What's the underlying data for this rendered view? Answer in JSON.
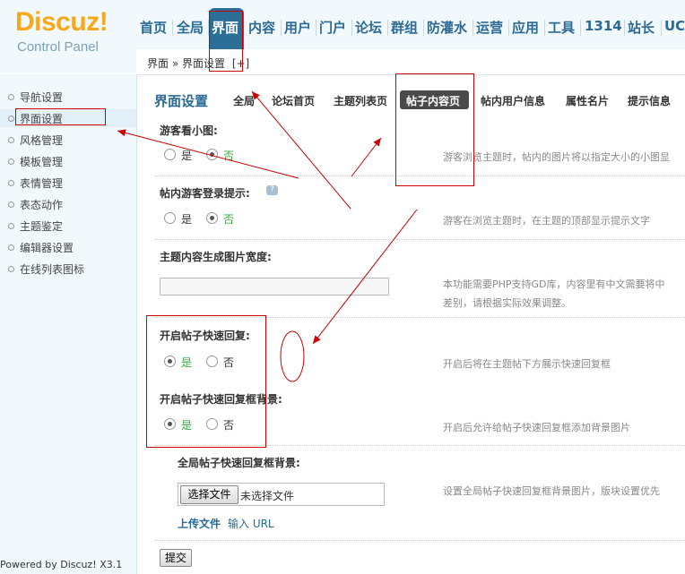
{
  "logo": {
    "brand": "Discuz!",
    "subtitle": "Control Panel"
  },
  "top_nav": [
    {
      "label": "首页"
    },
    {
      "label": "全局"
    },
    {
      "label": "界面"
    },
    {
      "label": "内容"
    },
    {
      "label": "用户"
    },
    {
      "label": "门户"
    },
    {
      "label": "论坛"
    },
    {
      "label": "群组"
    },
    {
      "label": "防灌水"
    },
    {
      "label": "运营"
    },
    {
      "label": "应用"
    },
    {
      "label": "工具"
    },
    {
      "label": "1314"
    },
    {
      "label": "站长"
    },
    {
      "label": "UCe"
    }
  ],
  "breadcrumb": {
    "text": "界面 » 界面设置",
    "toggle": "[+]"
  },
  "sidebar": {
    "items": [
      {
        "label": "导航设置"
      },
      {
        "label": "界面设置"
      },
      {
        "label": "风格管理"
      },
      {
        "label": "模板管理"
      },
      {
        "label": "表情管理"
      },
      {
        "label": "表态动作"
      },
      {
        "label": "主题鉴定"
      },
      {
        "label": "编辑器设置"
      },
      {
        "label": "在线列表图标"
      }
    ],
    "powered": "Powered by Discuz! X3.1"
  },
  "page": {
    "title": "界面设置",
    "tabs": [
      {
        "label": "全局"
      },
      {
        "label": "论坛首页"
      },
      {
        "label": "主题列表页"
      },
      {
        "label": "帖子内容页"
      },
      {
        "label": "帖内用户信息"
      },
      {
        "label": "属性名片"
      },
      {
        "label": "提示信息"
      }
    ]
  },
  "settings": {
    "s1": {
      "title": "游客看小图:",
      "yes": "是",
      "no": "否",
      "selected": "否",
      "desc": "游客浏览主题时，帖内的图片将以指定大小的小图显"
    },
    "s2": {
      "title": "帖内游客登录提示:",
      "yes": "是",
      "no": "否",
      "selected": "否",
      "desc": "游客在浏览主题时，在主题的顶部显示提示文字",
      "help": "?"
    },
    "s3": {
      "title": "主题内容生成图片宽度:",
      "value": "",
      "desc_line1": "本功能需要PHP支持GD库，内容里有中文需要将中",
      "desc_line2": "差别，请根据实际效果调整。"
    },
    "s4": {
      "title": "开启帖子快速回复:",
      "yes": "是",
      "no": "否",
      "selected": "是",
      "desc": "开启后将在主题帖下方展示快速回复框"
    },
    "s5": {
      "title": "开启帖子快速回复框背景:",
      "yes": "是",
      "no": "否",
      "selected": "是",
      "desc": "开启后允许给帖子快速回复框添加背景图片"
    },
    "s6": {
      "title": "全局帖子快速回复框背景:",
      "choose_button": "选择文件",
      "file_status": "未选择文件",
      "upload_link": "上传文件",
      "url_link": "输入 URL",
      "desc": "设置全局帖子快速回复框背景图片，版块设置优先"
    }
  },
  "submit_label": "提交",
  "colors": {
    "nav_text": "#2b6a94",
    "nav_active_bg": "#2b6e98",
    "logo": "#f7a81b",
    "annotation": "#cc0000",
    "yes_green": "#3aa845"
  }
}
